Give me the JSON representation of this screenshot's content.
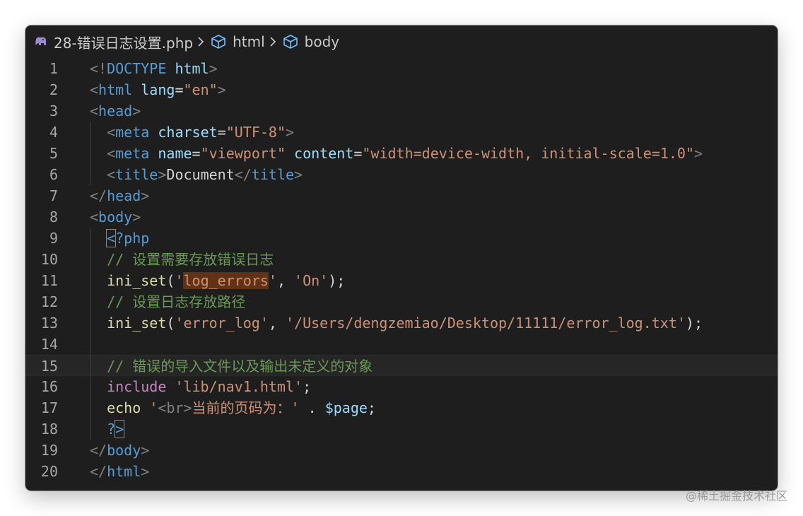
{
  "breadcrumb": {
    "file": "28-错误日志设置.php",
    "items": [
      "html",
      "body"
    ]
  },
  "watermark": "@稀土掘金技术社区",
  "lines": [
    {
      "num": "1",
      "tokens": [
        {
          "t": "<!",
          "c": "punc"
        },
        {
          "t": "DOCTYPE",
          "c": "tag"
        },
        {
          "t": " ",
          "c": "plain"
        },
        {
          "t": "html",
          "c": "attr"
        },
        {
          "t": ">",
          "c": "punc"
        }
      ]
    },
    {
      "num": "2",
      "tokens": [
        {
          "t": "<",
          "c": "punc"
        },
        {
          "t": "html",
          "c": "tag"
        },
        {
          "t": " ",
          "c": "plain"
        },
        {
          "t": "lang",
          "c": "attr"
        },
        {
          "t": "=",
          "c": "plain"
        },
        {
          "t": "\"en\"",
          "c": "str"
        },
        {
          "t": ">",
          "c": "punc"
        }
      ]
    },
    {
      "num": "3",
      "tokens": [
        {
          "t": "<",
          "c": "punc"
        },
        {
          "t": "head",
          "c": "tag"
        },
        {
          "t": ">",
          "c": "punc"
        }
      ]
    },
    {
      "num": "4",
      "tokens": [
        {
          "t": "  ",
          "c": "plain"
        },
        {
          "t": "<",
          "c": "punc"
        },
        {
          "t": "meta",
          "c": "tag"
        },
        {
          "t": " ",
          "c": "plain"
        },
        {
          "t": "charset",
          "c": "attr"
        },
        {
          "t": "=",
          "c": "plain"
        },
        {
          "t": "\"UTF-8\"",
          "c": "str"
        },
        {
          "t": ">",
          "c": "punc"
        }
      ]
    },
    {
      "num": "5",
      "tokens": [
        {
          "t": "  ",
          "c": "plain"
        },
        {
          "t": "<",
          "c": "punc"
        },
        {
          "t": "meta",
          "c": "tag"
        },
        {
          "t": " ",
          "c": "plain"
        },
        {
          "t": "name",
          "c": "attr"
        },
        {
          "t": "=",
          "c": "plain"
        },
        {
          "t": "\"viewport\"",
          "c": "str"
        },
        {
          "t": " ",
          "c": "plain"
        },
        {
          "t": "content",
          "c": "attr"
        },
        {
          "t": "=",
          "c": "plain"
        },
        {
          "t": "\"width=device-width, initial-scale=1.0\"",
          "c": "str"
        },
        {
          "t": ">",
          "c": "punc"
        }
      ]
    },
    {
      "num": "6",
      "tokens": [
        {
          "t": "  ",
          "c": "plain"
        },
        {
          "t": "<",
          "c": "punc"
        },
        {
          "t": "title",
          "c": "tag"
        },
        {
          "t": ">",
          "c": "punc"
        },
        {
          "t": "Document",
          "c": "plain"
        },
        {
          "t": "</",
          "c": "punc"
        },
        {
          "t": "title",
          "c": "tag"
        },
        {
          "t": ">",
          "c": "punc"
        }
      ]
    },
    {
      "num": "7",
      "tokens": [
        {
          "t": "</",
          "c": "punc"
        },
        {
          "t": "head",
          "c": "tag"
        },
        {
          "t": ">",
          "c": "punc"
        }
      ]
    },
    {
      "num": "8",
      "tokens": [
        {
          "t": "<",
          "c": "punc"
        },
        {
          "t": "body",
          "c": "tag"
        },
        {
          "t": ">",
          "c": "punc"
        }
      ]
    },
    {
      "num": "9",
      "tokens": [
        {
          "t": "  ",
          "c": "plain"
        },
        {
          "t": "<",
          "c": "php",
          "box": true
        },
        {
          "t": "?php",
          "c": "php"
        }
      ]
    },
    {
      "num": "10",
      "tokens": [
        {
          "t": "  ",
          "c": "plain"
        },
        {
          "t": "// 设置需要存放错误日志",
          "c": "cmt"
        }
      ]
    },
    {
      "num": "11",
      "tokens": [
        {
          "t": "  ",
          "c": "plain"
        },
        {
          "t": "ini_set",
          "c": "fn"
        },
        {
          "t": "(",
          "c": "plain"
        },
        {
          "t": "'",
          "c": "str"
        },
        {
          "t": "log_errors",
          "c": "str",
          "hl": true
        },
        {
          "t": "'",
          "c": "str"
        },
        {
          "t": ", ",
          "c": "plain"
        },
        {
          "t": "'On'",
          "c": "str"
        },
        {
          "t": ");",
          "c": "plain"
        }
      ]
    },
    {
      "num": "12",
      "tokens": [
        {
          "t": "  ",
          "c": "plain"
        },
        {
          "t": "// 设置日志存放路径",
          "c": "cmt"
        }
      ]
    },
    {
      "num": "13",
      "tokens": [
        {
          "t": "  ",
          "c": "plain"
        },
        {
          "t": "ini_set",
          "c": "fn"
        },
        {
          "t": "(",
          "c": "plain"
        },
        {
          "t": "'error_log'",
          "c": "str"
        },
        {
          "t": ", ",
          "c": "plain"
        },
        {
          "t": "'/Users/dengzemiao/Desktop/11111/error_log.txt'",
          "c": "str"
        },
        {
          "t": ");",
          "c": "plain"
        }
      ]
    },
    {
      "num": "14",
      "tokens": []
    },
    {
      "num": "15",
      "current": true,
      "tokens": [
        {
          "t": "  ",
          "c": "plain"
        },
        {
          "t": "// 错误的导入文件以及输出未定义的对象",
          "c": "cmt"
        }
      ]
    },
    {
      "num": "16",
      "tokens": [
        {
          "t": "  ",
          "c": "plain"
        },
        {
          "t": "include",
          "c": "kw"
        },
        {
          "t": " ",
          "c": "plain"
        },
        {
          "t": "'lib/nav1.html'",
          "c": "str"
        },
        {
          "t": ";",
          "c": "plain"
        }
      ]
    },
    {
      "num": "17",
      "tokens": [
        {
          "t": "  ",
          "c": "plain"
        },
        {
          "t": "echo",
          "c": "fn"
        },
        {
          "t": " ",
          "c": "plain"
        },
        {
          "t": "'",
          "c": "str"
        },
        {
          "t": "<br>",
          "c": "punc"
        },
        {
          "t": "当前的页码为：'",
          "c": "str"
        },
        {
          "t": " . ",
          "c": "plain"
        },
        {
          "t": "$page",
          "c": "var"
        },
        {
          "t": ";",
          "c": "plain"
        }
      ]
    },
    {
      "num": "18",
      "tokens": [
        {
          "t": "  ",
          "c": "plain"
        },
        {
          "t": "?",
          "c": "php"
        },
        {
          "t": ">",
          "c": "php",
          "box": true
        }
      ]
    },
    {
      "num": "19",
      "tokens": [
        {
          "t": "</",
          "c": "punc"
        },
        {
          "t": "body",
          "c": "tag"
        },
        {
          "t": ">",
          "c": "punc"
        }
      ]
    },
    {
      "num": "20",
      "tokens": [
        {
          "t": "</",
          "c": "punc"
        },
        {
          "t": "html",
          "c": "tag"
        },
        {
          "t": ">",
          "c": "punc"
        }
      ]
    }
  ]
}
